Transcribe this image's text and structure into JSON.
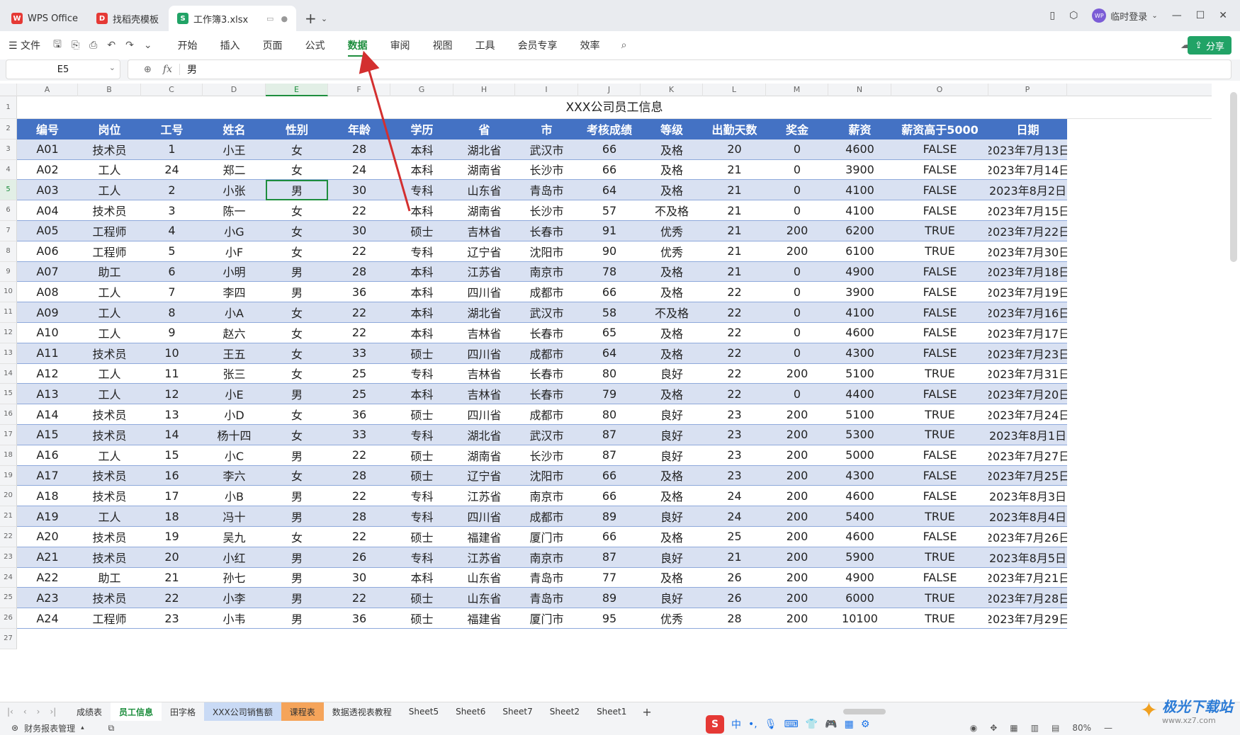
{
  "tabs": [
    {
      "label": "WPS Office",
      "logo": "W"
    },
    {
      "label": "找稻壳模板",
      "logo": "D"
    },
    {
      "label": "工作簿3.xlsx",
      "logo": "S"
    }
  ],
  "user": {
    "label": "临时登录",
    "avatar": "WP"
  },
  "menu": {
    "file": "文件",
    "items": [
      "开始",
      "插入",
      "页面",
      "公式",
      "数据",
      "审阅",
      "视图",
      "工具",
      "会员专享",
      "效率"
    ],
    "active": "数据",
    "share": "分享"
  },
  "formula_bar": {
    "cell_ref": "E5",
    "fx": "fx",
    "value": "男"
  },
  "columns": [
    "A",
    "B",
    "C",
    "D",
    "E",
    "F",
    "G",
    "H",
    "I",
    "J",
    "K",
    "L",
    "M",
    "N",
    "O",
    "P"
  ],
  "selected_column": "E",
  "selected_row": 5,
  "sheet_title": "XXX公司员工信息",
  "table_headers": [
    "编号",
    "岗位",
    "工号",
    "姓名",
    "性别",
    "年龄",
    "学历",
    "省",
    "市",
    "考核成绩",
    "等级",
    "出勤天数",
    "奖金",
    "薪资",
    "薪资高于5000",
    "日期"
  ],
  "rows": [
    [
      "A01",
      "技术员",
      "1",
      "小王",
      "女",
      "28",
      "本科",
      "湖北省",
      "武汉市",
      "66",
      "及格",
      "20",
      "0",
      "4600",
      "FALSE",
      "2023年7月13日"
    ],
    [
      "A02",
      "工人",
      "24",
      "郑二",
      "女",
      "24",
      "本科",
      "湖南省",
      "长沙市",
      "66",
      "及格",
      "21",
      "0",
      "3900",
      "FALSE",
      "2023年7月14日"
    ],
    [
      "A03",
      "工人",
      "2",
      "小张",
      "男",
      "30",
      "专科",
      "山东省",
      "青岛市",
      "64",
      "及格",
      "21",
      "0",
      "4100",
      "FALSE",
      "2023年8月2日"
    ],
    [
      "A04",
      "技术员",
      "3",
      "陈一",
      "女",
      "22",
      "本科",
      "湖南省",
      "长沙市",
      "57",
      "不及格",
      "21",
      "0",
      "4100",
      "FALSE",
      "2023年7月15日"
    ],
    [
      "A05",
      "工程师",
      "4",
      "小G",
      "女",
      "30",
      "硕士",
      "吉林省",
      "长春市",
      "91",
      "优秀",
      "21",
      "200",
      "6200",
      "TRUE",
      "2023年7月22日"
    ],
    [
      "A06",
      "工程师",
      "5",
      "小F",
      "女",
      "22",
      "专科",
      "辽宁省",
      "沈阳市",
      "90",
      "优秀",
      "21",
      "200",
      "6100",
      "TRUE",
      "2023年7月30日"
    ],
    [
      "A07",
      "助工",
      "6",
      "小明",
      "男",
      "28",
      "本科",
      "江苏省",
      "南京市",
      "78",
      "及格",
      "21",
      "0",
      "4900",
      "FALSE",
      "2023年7月18日"
    ],
    [
      "A08",
      "工人",
      "7",
      "李四",
      "男",
      "36",
      "本科",
      "四川省",
      "成都市",
      "66",
      "及格",
      "22",
      "0",
      "3900",
      "FALSE",
      "2023年7月19日"
    ],
    [
      "A09",
      "工人",
      "8",
      "小A",
      "女",
      "22",
      "本科",
      "湖北省",
      "武汉市",
      "58",
      "不及格",
      "22",
      "0",
      "4100",
      "FALSE",
      "2023年7月16日"
    ],
    [
      "A10",
      "工人",
      "9",
      "赵六",
      "女",
      "22",
      "本科",
      "吉林省",
      "长春市",
      "65",
      "及格",
      "22",
      "0",
      "4600",
      "FALSE",
      "2023年7月17日"
    ],
    [
      "A11",
      "技术员",
      "10",
      "王五",
      "女",
      "33",
      "硕士",
      "四川省",
      "成都市",
      "64",
      "及格",
      "22",
      "0",
      "4300",
      "FALSE",
      "2023年7月23日"
    ],
    [
      "A12",
      "工人",
      "11",
      "张三",
      "女",
      "25",
      "专科",
      "吉林省",
      "长春市",
      "80",
      "良好",
      "22",
      "200",
      "5100",
      "TRUE",
      "2023年7月31日"
    ],
    [
      "A13",
      "工人",
      "12",
      "小E",
      "男",
      "25",
      "本科",
      "吉林省",
      "长春市",
      "79",
      "及格",
      "22",
      "0",
      "4400",
      "FALSE",
      "2023年7月20日"
    ],
    [
      "A14",
      "技术员",
      "13",
      "小D",
      "女",
      "36",
      "硕士",
      "四川省",
      "成都市",
      "80",
      "良好",
      "23",
      "200",
      "5100",
      "TRUE",
      "2023年7月24日"
    ],
    [
      "A15",
      "技术员",
      "14",
      "杨十四",
      "女",
      "33",
      "专科",
      "湖北省",
      "武汉市",
      "87",
      "良好",
      "23",
      "200",
      "5300",
      "TRUE",
      "2023年8月1日"
    ],
    [
      "A16",
      "工人",
      "15",
      "小C",
      "男",
      "22",
      "硕士",
      "湖南省",
      "长沙市",
      "87",
      "良好",
      "23",
      "200",
      "5000",
      "FALSE",
      "2023年7月27日"
    ],
    [
      "A17",
      "技术员",
      "16",
      "李六",
      "女",
      "28",
      "硕士",
      "辽宁省",
      "沈阳市",
      "66",
      "及格",
      "23",
      "200",
      "4300",
      "FALSE",
      "2023年7月25日"
    ],
    [
      "A18",
      "技术员",
      "17",
      "小B",
      "男",
      "22",
      "专科",
      "江苏省",
      "南京市",
      "66",
      "及格",
      "24",
      "200",
      "4600",
      "FALSE",
      "2023年8月3日"
    ],
    [
      "A19",
      "工人",
      "18",
      "冯十",
      "男",
      "28",
      "专科",
      "四川省",
      "成都市",
      "89",
      "良好",
      "24",
      "200",
      "5400",
      "TRUE",
      "2023年8月4日"
    ],
    [
      "A20",
      "技术员",
      "19",
      "吴九",
      "女",
      "22",
      "硕士",
      "福建省",
      "厦门市",
      "66",
      "及格",
      "25",
      "200",
      "4600",
      "FALSE",
      "2023年7月26日"
    ],
    [
      "A21",
      "技术员",
      "20",
      "小红",
      "男",
      "26",
      "专科",
      "江苏省",
      "南京市",
      "87",
      "良好",
      "21",
      "200",
      "5900",
      "TRUE",
      "2023年8月5日"
    ],
    [
      "A22",
      "助工",
      "21",
      "孙七",
      "男",
      "30",
      "本科",
      "山东省",
      "青岛市",
      "77",
      "及格",
      "26",
      "200",
      "4900",
      "FALSE",
      "2023年7月21日"
    ],
    [
      "A23",
      "技术员",
      "22",
      "小李",
      "男",
      "22",
      "硕士",
      "山东省",
      "青岛市",
      "89",
      "良好",
      "26",
      "200",
      "6000",
      "TRUE",
      "2023年7月28日"
    ],
    [
      "A24",
      "工程师",
      "23",
      "小韦",
      "男",
      "36",
      "硕士",
      "福建省",
      "厦门市",
      "95",
      "优秀",
      "28",
      "200",
      "10100",
      "TRUE",
      "2023年7月29日"
    ]
  ],
  "sheets": [
    {
      "label": "成绩表",
      "style": "normal"
    },
    {
      "label": "员工信息",
      "style": "active"
    },
    {
      "label": "田字格",
      "style": "normal"
    },
    {
      "label": "XXX公司销售额",
      "style": "blue"
    },
    {
      "label": "课程表",
      "style": "orange"
    },
    {
      "label": "数据透视表教程",
      "style": "normal"
    },
    {
      "label": "Sheet5",
      "style": "normal"
    },
    {
      "label": "Sheet6",
      "style": "normal"
    },
    {
      "label": "Sheet7",
      "style": "normal"
    },
    {
      "label": "Sheet2",
      "style": "normal"
    },
    {
      "label": "Sheet1",
      "style": "normal"
    }
  ],
  "status": {
    "left": "财务报表管理",
    "zoom": "80%"
  },
  "watermark": {
    "title": "极光下载站",
    "url": "www.xz7.com"
  },
  "colors": {
    "header_blue": "#4472c4",
    "band_blue": "#d9e1f2",
    "accent_green": "#1e8e3e",
    "annotation_red": "#d32f2f"
  }
}
